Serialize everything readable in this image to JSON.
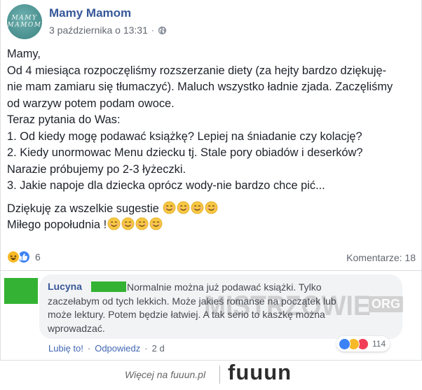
{
  "post": {
    "avatar_text_top": "MAMY",
    "avatar_text_bottom": "MAMOM",
    "author": "Mamy Mamom",
    "date": "3 października o 13:31",
    "separator": "·",
    "privacy_icon": "globe-icon",
    "lines": [
      "Mamy,",
      "Od 4 miesiąca rozpoczęliśmy rozszerzanie diety (za hejty bardzo dziękuję-",
      "nie mam zamiaru się tłumaczyć). Maluch wszystko ładnie zjada. Zaczęliśmy",
      "od warzyw potem podam owoce.",
      "Teraz pytania do Was:",
      "1. Od kiedy mogę podawać książkę? Lepiej na śniadanie czy kolację?",
      "2. Kiedy unormowac Menu dziecku tj. Stale pory obiadów i deserków?",
      "Narazie próbujemy po 2-3 łyżeczki.",
      "3. Jakie napoje dla dziecka oprócz wody-nie bardzo chce pić..."
    ],
    "thanks_line": "Dziękuję za wszelkie sugestie",
    "afternoon_line": "Miłego popołudnia !",
    "emoji_icon": "smiling-face-icon",
    "reactions": [
      "haha-icon",
      "like-icon"
    ],
    "reaction_count": "6",
    "comments_label": "Komentarze: 18"
  },
  "comment": {
    "author": "Lucyna",
    "text_lines": [
      "Normalnie można już podawać książki. Tylko",
      "zaczełabym od tych lekkich. Może jakieś romanse na początek lub",
      "może lektury. Potem będzie łatwiej. A tak serio to kaszkę można",
      "wprowadzać."
    ],
    "like_link": "Lubię to!",
    "reply_link": "Odpowiedz",
    "age": "2 d",
    "separator": "·",
    "reactions": [
      "like-icon",
      "haha-icon",
      "love-icon"
    ],
    "reaction_count": "114"
  },
  "watermark": {
    "text": "MISTRZOWIE",
    "tag": "ORG"
  },
  "footer": {
    "more_text": "Więcej na fuuun.pl",
    "logo": "fuuun"
  },
  "colors": {
    "link_blue": "#365899",
    "redaction_green": "#34b233",
    "haha_yellow": "#f7b928",
    "like_blue": "#3b82f6",
    "love_red": "#f33e58",
    "logo_accent": "#f2a900"
  }
}
